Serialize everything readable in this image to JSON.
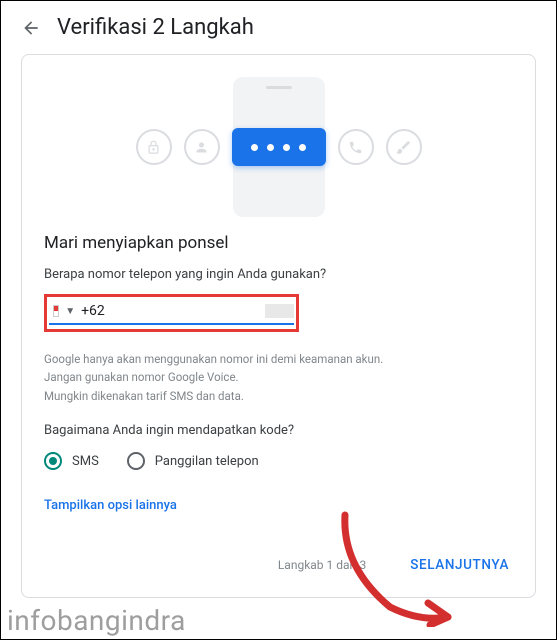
{
  "header": {
    "title": "Verifikasi 2 Langkah"
  },
  "illustration": {
    "icons": [
      "lock-icon",
      "person-icon",
      "password-pill",
      "phone-icon",
      "key-icon"
    ]
  },
  "section": {
    "heading": "Mari menyiapkan ponsel",
    "question": "Berapa nomor telepon yang ingin Anda gunakan?"
  },
  "phone_input": {
    "country_flag": "indonesia",
    "value": "+62"
  },
  "hints": {
    "line1": "Google hanya akan menggunakan nomor ini demi keamanan akun.",
    "line2": "Jangan gunakan nomor Google Voice.",
    "line3": "Mungkin dikenakan tarif SMS dan data."
  },
  "method": {
    "question": "Bagaimana Anda ingin mendapatkan kode?",
    "options": {
      "sms": "SMS",
      "call": "Panggilan telepon"
    },
    "selected": "sms"
  },
  "show_more": "Tampilkan opsi lainnya",
  "footer": {
    "step": "Langkab 1 dari 3",
    "next": "SELANJUTNYA"
  },
  "watermark": "infobangindra",
  "colors": {
    "primary": "#1a73e8",
    "highlight_border": "#e53935",
    "radio_selected": "#00897b"
  }
}
